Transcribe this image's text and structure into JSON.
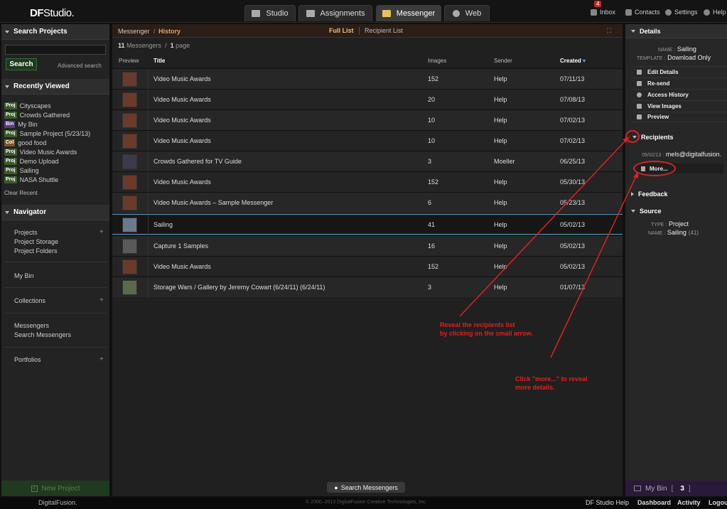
{
  "app": {
    "logo_main": "DF",
    "logo_sub": "Studio."
  },
  "tabs": [
    {
      "label": "Studio"
    },
    {
      "label": "Assignments"
    },
    {
      "label": "Messenger"
    },
    {
      "label": "Web"
    }
  ],
  "toplinks": {
    "inbox": "Inbox",
    "inbox_count": "4",
    "contacts": "Contacts",
    "settings": "Settings",
    "help": "Help"
  },
  "sidebar": {
    "search_title": "Search Projects",
    "search_value": "",
    "search_button": "Search",
    "advanced": "Advanced search",
    "recent_title": "Recently Viewed",
    "recent": [
      {
        "badge": "Proj",
        "label": "Cityscapes"
      },
      {
        "badge": "Proj",
        "label": "Crowds Gathered"
      },
      {
        "badge": "Bin",
        "label": "My Bin"
      },
      {
        "badge": "Proj",
        "label": "Sample Project (5/23/13)"
      },
      {
        "badge": "Col",
        "label": "good food"
      },
      {
        "badge": "Proj",
        "label": "Video Music Awards"
      },
      {
        "badge": "Proj",
        "label": "Demo Upload"
      },
      {
        "badge": "Proj",
        "label": "Sailing"
      },
      {
        "badge": "Proj",
        "label": "NASA Shuttle"
      }
    ],
    "clear_recent": "Clear Recent",
    "navigator_title": "Navigator",
    "nav": {
      "projects": "Projects",
      "project_storage": "Project Storage",
      "project_folders": "Project Folders",
      "my_bin": "My Bin",
      "collections": "Collections",
      "messengers": "Messengers",
      "search_messengers": "Search Messengers",
      "portfolios": "Portfolios"
    },
    "new_project": "New Project"
  },
  "center": {
    "crumb_root": "Messenger",
    "crumb_current": "History",
    "full_list": "Full List",
    "recipient_list": "Recipient List",
    "count_num": "11",
    "count_label": "Messengers",
    "page_num": "1",
    "page_label": "page",
    "columns": {
      "preview": "Preview",
      "title": "Title",
      "images": "Images",
      "sender": "Sender",
      "created": "Created"
    },
    "rows": [
      {
        "title": "Video Music Awards",
        "images": "152",
        "sender": "Help",
        "created": "07/11/13"
      },
      {
        "title": "Video Music Awards",
        "images": "20",
        "sender": "Help",
        "created": "07/08/13"
      },
      {
        "title": "Video Music Awards",
        "images": "10",
        "sender": "Help",
        "created": "07/02/13"
      },
      {
        "title": "Video Music Awards",
        "images": "10",
        "sender": "Help",
        "created": "07/02/13"
      },
      {
        "title": "Crowds Gathered for TV Guide",
        "images": "3",
        "sender": "Moeller",
        "created": "06/25/13"
      },
      {
        "title": "Video Music Awards",
        "images": "152",
        "sender": "Help",
        "created": "05/30/13"
      },
      {
        "title": "Video Music Awards – Sample Messenger",
        "images": "6",
        "sender": "Help",
        "created": "05/23/13"
      },
      {
        "title": "Sailing",
        "images": "41",
        "sender": "Help",
        "created": "05/02/13"
      },
      {
        "title": "Capture 1 Samples",
        "images": "16",
        "sender": "Help",
        "created": "05/02/13"
      },
      {
        "title": "Video Music Awards",
        "images": "152",
        "sender": "Help",
        "created": "05/02/13"
      },
      {
        "title": "Storage Wars / Gallery by Jeremy Cowart (6/24/11) (6/24/11)",
        "images": "3",
        "sender": "Help",
        "created": "01/07/13"
      }
    ],
    "search_messengers": "Search Messengers"
  },
  "details": {
    "title": "Details",
    "name_label": "NAME :",
    "name_value": "Sailing",
    "template_label": "TEMPLATE :",
    "template_value": "Download Only",
    "actions": [
      "Edit Details",
      "Re-send",
      "Access History",
      "View Images",
      "Preview"
    ],
    "recipients_title": "Recipients",
    "recipient_date": "05/02/13 :",
    "recipient_email": "mels@digitalfusion.",
    "more": "More...",
    "feedback_title": "Feedback",
    "source_title": "Source",
    "type_label": "TYPE :",
    "type_value": "Project",
    "src_name_label": "NAME :",
    "src_name_value": "Sailing",
    "src_count": "(41)"
  },
  "mybin": {
    "label": "My Bin",
    "count": "3"
  },
  "footer": {
    "brand": "DigitalFusion.",
    "copyright": "© 2000–2013 DigitalFusion Creative Technologies, Inc.",
    "links": [
      "DF Studio Help",
      "Dashboard",
      "Activity",
      "Logout"
    ]
  },
  "annotations": {
    "note1_l1": "Reveal the recipients list",
    "note1_l2": "by clicking on the small arrow.",
    "note2_l1": "Click \"more...\" to reveal",
    "note2_l2": "more details."
  },
  "colors": {
    "annotation": "#e02020",
    "accent": "#e8a060",
    "selected_border": "#4aa0d0"
  }
}
